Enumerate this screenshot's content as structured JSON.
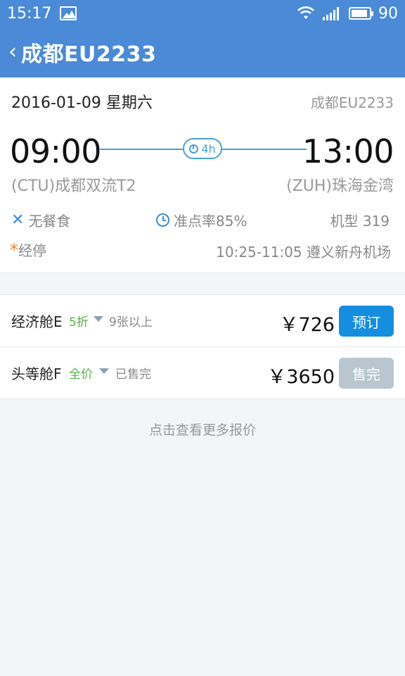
{
  "status_bar": {
    "time": "15:17",
    "battery": "90"
  },
  "header": {
    "title": "成都EU2233"
  },
  "flight": {
    "date": "2016-01-09 星期六",
    "flight_no": "成都EU2233",
    "dep_time": "09:00",
    "arr_time": "13:00",
    "duration": "4h",
    "dep_airport": "(CTU)成都双流T2",
    "arr_airport": "(ZUH)珠海金湾",
    "meal": "无餐食",
    "punctuality": "准点率85%",
    "aircraft": "机型 319",
    "stop_label": "经停",
    "stop_info": "10:25-11:05 遵义新舟机场"
  },
  "cabins": [
    {
      "name": "经济舱E",
      "discount": "5折",
      "seats": "9张以上",
      "price": "￥726",
      "action": "预订"
    },
    {
      "name": "头等舱F",
      "discount": "全价",
      "seats": "已售完",
      "price": "￥3650",
      "action": "售完"
    }
  ],
  "more_prices": "点击查看更多报价"
}
